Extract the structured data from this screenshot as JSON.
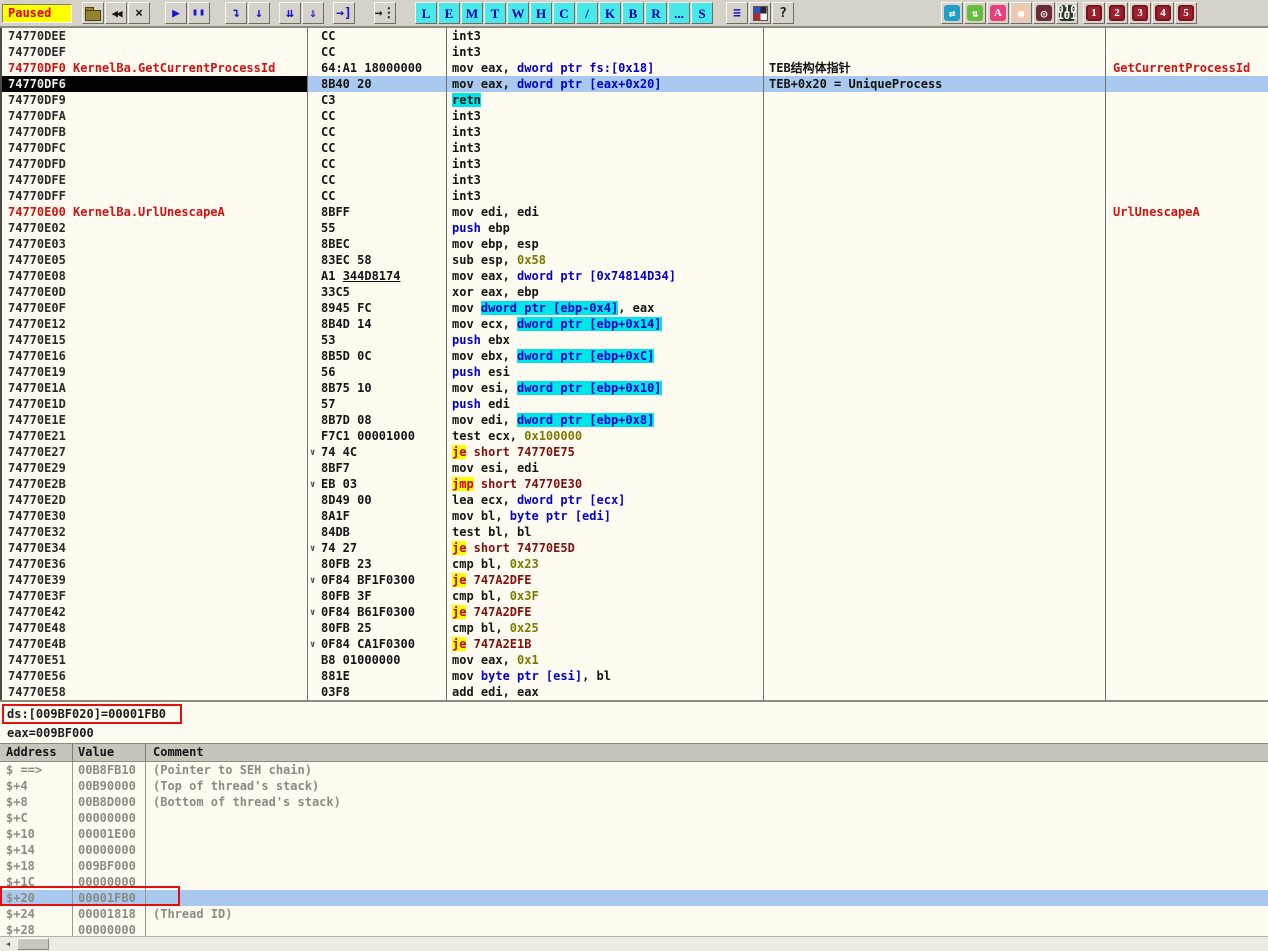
{
  "toolbar": {
    "status": "Paused",
    "buttons": [
      {
        "gap": 4
      },
      {
        "name": "open-button",
        "icon": "open-folder-icon",
        "shape": "icon-folder",
        "glyph": ""
      },
      {
        "name": "restart-button",
        "icon": "restart-icon",
        "cls": "g-black-sm",
        "glyph": "◀◀"
      },
      {
        "name": "close-button",
        "icon": "close-icon",
        "cls": "g-black",
        "glyph": "×"
      },
      {
        "gap": 14
      },
      {
        "name": "run-button",
        "icon": "play-icon",
        "cls": "g-blue",
        "glyph": "▶"
      },
      {
        "name": "pause-button",
        "icon": "pause-icon",
        "cls": "g-blue-sm",
        "glyph": "▮▮"
      },
      {
        "gap": 14
      },
      {
        "name": "step-into-button",
        "icon": "step-into-icon",
        "cls": "g-blue",
        "glyph": "↴"
      },
      {
        "name": "step-over-button",
        "icon": "step-over-icon",
        "cls": "g-blue",
        "glyph": "↓"
      },
      {
        "gap": 8
      },
      {
        "name": "animate-into-button",
        "icon": "animate-into-icon",
        "cls": "g-blue",
        "glyph": "⇊"
      },
      {
        "name": "animate-over-button",
        "icon": "animate-over-icon",
        "cls": "g-blue",
        "glyph": "⇓"
      },
      {
        "gap": 8
      },
      {
        "name": "execute-till-return-button",
        "icon": "return-icon",
        "cls": "g-blue",
        "glyph": "→]"
      },
      {
        "gap": 18
      },
      {
        "name": "goto-button",
        "icon": "goto-icon",
        "cls": "g-black",
        "glyph": "→⋮"
      },
      {
        "gap": 18
      },
      {
        "name": "log-window-button",
        "btncls": "cyanb",
        "glyph": "L"
      },
      {
        "name": "executables-button",
        "btncls": "cyanb",
        "glyph": "E"
      },
      {
        "name": "memory-map-button",
        "btncls": "cyanb",
        "glyph": "M"
      },
      {
        "name": "threads-button",
        "btncls": "cyanb",
        "glyph": "T"
      },
      {
        "name": "windows-button",
        "btncls": "cyanb",
        "glyph": "W"
      },
      {
        "name": "handles-button",
        "btncls": "cyanb",
        "glyph": "H"
      },
      {
        "name": "cpu-window-button",
        "btncls": "cyanb",
        "glyph": "C"
      },
      {
        "name": "patches-button",
        "btncls": "cyanb",
        "glyph": "/"
      },
      {
        "name": "call-stack-button",
        "btncls": "cyanb",
        "glyph": "K"
      },
      {
        "name": "breakpoints-button",
        "btncls": "cyanb",
        "glyph": "B"
      },
      {
        "name": "references-button",
        "btncls": "cyanb",
        "glyph": "R"
      },
      {
        "name": "run-trace-button",
        "btncls": "cyanb",
        "glyph": "..."
      },
      {
        "name": "source-button",
        "btncls": "cyanb",
        "glyph": "S"
      },
      {
        "gap": 12
      },
      {
        "name": "windows-list-button",
        "icon": "list-icon",
        "cls": "g-blue",
        "glyph": "≡"
      },
      {
        "name": "appearance-button",
        "icon": "color-grid-icon",
        "shape": "icon-grid",
        "glyph": ""
      },
      {
        "name": "help-button",
        "icon": "question-icon",
        "cls": "g-black",
        "glyph": "?"
      },
      {
        "gap": 146
      },
      {
        "name": "plugin-exchange-button",
        "btncls": "plug p-teal",
        "icon": "exchange-arrows-icon",
        "glyph": "⇄"
      },
      {
        "name": "plugin-updown-button",
        "btncls": "plug p-green",
        "icon": "up-down-arrows-icon",
        "glyph": "⇅"
      },
      {
        "name": "plugin-analyze-button",
        "btncls": "plug p-pink",
        "icon": "letter-a-icon",
        "glyph": "A"
      },
      {
        "name": "plugin-ball-button",
        "btncls": "plug p-ball",
        "icon": "orange-ball-icon",
        "glyph": "●"
      },
      {
        "name": "plugin-spiral-button",
        "btncls": "plug p-spiral",
        "icon": "spiral-icon",
        "glyph": "◎"
      },
      {
        "name": "plugin-binary-button",
        "btncls": "plug p-bin",
        "icon": "binary-icon",
        "glyph": "010 101"
      },
      {
        "gap": 4
      },
      {
        "name": "plugin-button-1",
        "btncls": "plug p-num",
        "glyph": "1"
      },
      {
        "name": "plugin-button-2",
        "btncls": "plug p-num",
        "glyph": "2"
      },
      {
        "name": "plugin-button-3",
        "btncls": "plug p-num",
        "glyph": "3"
      },
      {
        "name": "plugin-button-4",
        "btncls": "plug p-num",
        "glyph": "4"
      },
      {
        "name": "plugin-button-5",
        "btncls": "plug p-num",
        "glyph": "5"
      }
    ]
  },
  "disasm": {
    "rows": [
      {
        "a": "74770DEE",
        "hex": "CC",
        "s": [
          [
            "int3",
            "p"
          ]
        ]
      },
      {
        "a": "74770DEF",
        "hex": "CC",
        "s": [
          [
            "int3",
            "p"
          ]
        ]
      },
      {
        "a": "74770DF0",
        "lbl": " KernelBa.GetCurrentProcessId",
        "red": true,
        "hex": "64:A1 18000000",
        "s": [
          [
            "mov eax, ",
            "p"
          ],
          [
            "dword ptr fs:[0x18]",
            "m"
          ]
        ],
        "c": "TEB结构体指针",
        "f": "GetCurrentProcessId"
      },
      {
        "a": "74770DF6",
        "sel": true,
        "hex": "8B40 20",
        "s": [
          [
            "mov eax, ",
            "p"
          ],
          [
            "dword ptr [eax+0x20]",
            "m"
          ]
        ],
        "c": "TEB+0x20 = UniqueProcess"
      },
      {
        "a": "74770DF9",
        "hex": "C3",
        "s": [
          [
            "retn",
            "r"
          ]
        ]
      },
      {
        "a": "74770DFA",
        "hex": "CC",
        "s": [
          [
            "int3",
            "p"
          ]
        ]
      },
      {
        "a": "74770DFB",
        "hex": "CC",
        "s": [
          [
            "int3",
            "p"
          ]
        ]
      },
      {
        "a": "74770DFC",
        "hex": "CC",
        "s": [
          [
            "int3",
            "p"
          ]
        ]
      },
      {
        "a": "74770DFD",
        "hex": "CC",
        "s": [
          [
            "int3",
            "p"
          ]
        ]
      },
      {
        "a": "74770DFE",
        "hex": "CC",
        "s": [
          [
            "int3",
            "p"
          ]
        ]
      },
      {
        "a": "74770DFF",
        "hex": "CC",
        "s": [
          [
            "int3",
            "p"
          ]
        ]
      },
      {
        "a": "74770E00",
        "lbl": " KernelBa.UrlUnescapeA",
        "red": true,
        "hex": "8BFF",
        "s": [
          [
            "mov edi, edi",
            "p"
          ]
        ],
        "f": "UrlUnescapeA"
      },
      {
        "a": "74770E02",
        "hex": "55",
        "s": [
          [
            "push",
            "k"
          ],
          [
            " ebp",
            "p"
          ]
        ]
      },
      {
        "a": "74770E03",
        "hex": "8BEC",
        "s": [
          [
            "mov ebp, esp",
            "p"
          ]
        ]
      },
      {
        "a": "74770E05",
        "hex": "83EC 58",
        "s": [
          [
            "sub esp, ",
            "p"
          ],
          [
            "0x58",
            "i"
          ]
        ]
      },
      {
        "a": "74770E08",
        "hex": "A1 ",
        "hexu": "344D8174",
        "s": [
          [
            "mov eax, ",
            "p"
          ],
          [
            "dword ptr [0x74814D34]",
            "m"
          ]
        ]
      },
      {
        "a": "74770E0D",
        "hex": "33C5",
        "s": [
          [
            "xor eax, ebp",
            "p"
          ]
        ]
      },
      {
        "a": "74770E0F",
        "hex": "8945 FC",
        "s": [
          [
            "mov ",
            "p"
          ],
          [
            "dword ptr [ebp-0x4]",
            "h"
          ],
          [
            ", eax",
            "p"
          ]
        ]
      },
      {
        "a": "74770E12",
        "hex": "8B4D 14",
        "s": [
          [
            "mov ecx, ",
            "p"
          ],
          [
            "dword ptr [ebp+0x14]",
            "h"
          ]
        ]
      },
      {
        "a": "74770E15",
        "hex": "53",
        "s": [
          [
            "push",
            "k"
          ],
          [
            " ebx",
            "p"
          ]
        ]
      },
      {
        "a": "74770E16",
        "hex": "8B5D 0C",
        "s": [
          [
            "mov ebx, ",
            "p"
          ],
          [
            "dword ptr [ebp+0xC]",
            "h"
          ]
        ]
      },
      {
        "a": "74770E19",
        "hex": "56",
        "s": [
          [
            "push",
            "k"
          ],
          [
            " esi",
            "p"
          ]
        ]
      },
      {
        "a": "74770E1A",
        "hex": "8B75 10",
        "s": [
          [
            "mov esi, ",
            "p"
          ],
          [
            "dword ptr [ebp+0x10]",
            "h"
          ]
        ]
      },
      {
        "a": "74770E1D",
        "hex": "57",
        "s": [
          [
            "push",
            "k"
          ],
          [
            " edi",
            "p"
          ]
        ]
      },
      {
        "a": "74770E1E",
        "hex": "8B7D 08",
        "s": [
          [
            "mov edi, ",
            "p"
          ],
          [
            "dword ptr [ebp+0x8]",
            "h"
          ]
        ]
      },
      {
        "a": "74770E21",
        "hex": "F7C1 00001000",
        "s": [
          [
            "test ecx, ",
            "p"
          ],
          [
            "0x100000",
            "i"
          ]
        ]
      },
      {
        "a": "74770E27",
        "hint": true,
        "hex": "74 4C",
        "s": [
          [
            "je",
            "j"
          ],
          [
            " short 74770E75",
            "t"
          ]
        ]
      },
      {
        "a": "74770E29",
        "hex": "8BF7",
        "s": [
          [
            "mov esi, edi",
            "p"
          ]
        ]
      },
      {
        "a": "74770E2B",
        "hint": true,
        "hex": "EB 03",
        "s": [
          [
            "jmp",
            "j"
          ],
          [
            " short 74770E30",
            "t"
          ]
        ]
      },
      {
        "a": "74770E2D",
        "hex": "8D49 00",
        "s": [
          [
            "lea ecx, ",
            "p"
          ],
          [
            "dword ptr [ecx]",
            "m"
          ]
        ]
      },
      {
        "a": "74770E30",
        "hex": "8A1F",
        "s": [
          [
            "mov bl, ",
            "p"
          ],
          [
            "byte ptr [edi]",
            "m"
          ]
        ]
      },
      {
        "a": "74770E32",
        "hex": "84DB",
        "s": [
          [
            "test bl, bl",
            "p"
          ]
        ]
      },
      {
        "a": "74770E34",
        "hint": true,
        "hex": "74 27",
        "s": [
          [
            "je",
            "j"
          ],
          [
            " short 74770E5D",
            "t"
          ]
        ]
      },
      {
        "a": "74770E36",
        "hex": "80FB 23",
        "s": [
          [
            "cmp bl, ",
            "p"
          ],
          [
            "0x23",
            "i"
          ]
        ]
      },
      {
        "a": "74770E39",
        "hint": true,
        "hex": "0F84 BF1F0300",
        "s": [
          [
            "je",
            "j"
          ],
          [
            " 747A2DFE",
            "t"
          ]
        ]
      },
      {
        "a": "74770E3F",
        "hex": "80FB 3F",
        "s": [
          [
            "cmp bl, ",
            "p"
          ],
          [
            "0x3F",
            "i"
          ]
        ]
      },
      {
        "a": "74770E42",
        "hint": true,
        "hex": "0F84 B61F0300",
        "s": [
          [
            "je",
            "j"
          ],
          [
            " 747A2DFE",
            "t"
          ]
        ]
      },
      {
        "a": "74770E48",
        "hex": "80FB 25",
        "s": [
          [
            "cmp bl, ",
            "p"
          ],
          [
            "0x25",
            "i"
          ]
        ]
      },
      {
        "a": "74770E4B",
        "hint": true,
        "hex": "0F84 CA1F0300",
        "s": [
          [
            "je",
            "j"
          ],
          [
            " 747A2E1B",
            "t"
          ]
        ]
      },
      {
        "a": "74770E51",
        "hex": "B8 01000000",
        "s": [
          [
            "mov eax, ",
            "p"
          ],
          [
            "0x1",
            "i"
          ]
        ]
      },
      {
        "a": "74770E56",
        "hex": "881E",
        "s": [
          [
            "mov ",
            "p"
          ],
          [
            "byte ptr [esi]",
            "m"
          ],
          [
            ", bl",
            "p"
          ]
        ]
      },
      {
        "a": "74770E58",
        "hex": "03F8",
        "s": [
          [
            "add edi, eax",
            "p"
          ]
        ]
      }
    ]
  },
  "info_pane": {
    "line1": "ds:[009BF020]=00001FB0",
    "line2": "eax=009BF000"
  },
  "stack": {
    "headers": [
      "Address",
      "Value",
      "Comment"
    ],
    "rows": [
      {
        "a": "$ ==>",
        "v": "00B8FB10",
        "c": "(Pointer to SEH chain)"
      },
      {
        "a": "$+4",
        "v": "00B90000",
        "c": "(Top of thread's stack)"
      },
      {
        "a": "$+8",
        "v": "00B8D000",
        "c": "(Bottom of thread's stack)"
      },
      {
        "a": "$+C",
        "v": "00000000",
        "c": ""
      },
      {
        "a": "$+10",
        "v": "00001E00",
        "c": ""
      },
      {
        "a": "$+14",
        "v": "00000000",
        "c": ""
      },
      {
        "a": "$+18",
        "v": "009BF000",
        "c": ""
      },
      {
        "a": "$+1C",
        "v": "00000000",
        "c": ""
      },
      {
        "a": "$+20",
        "v": "00001FB0",
        "c": "",
        "sel": true,
        "boxed": true
      },
      {
        "a": "$+24",
        "v": "00001818",
        "c": "(Thread ID)"
      },
      {
        "a": "$+28",
        "v": "00000000",
        "c": ""
      }
    ]
  },
  "colors": {
    "pane_bg": "#FFFBF0",
    "toolbar_bg": "#D6D2C9",
    "selection_blue": "#A9CAEE",
    "memory_operand_blue": "#0000CC",
    "stack_operand_cyan_bg": "#00E6E6",
    "immediate_olive": "#7A7A00",
    "jump_red_on_yellow": "#CC0000/#FFFF00",
    "jump_target_maroon": "#801010",
    "label_red": "#D01212",
    "stack_text_gray": "#8B8B84",
    "annotation_red": "#E01010",
    "status_paused_yellow": "#FFFF00"
  }
}
